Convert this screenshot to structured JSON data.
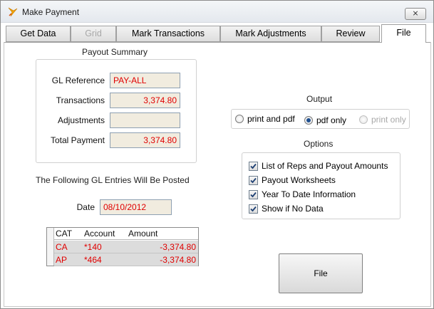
{
  "window": {
    "title": "Make Payment",
    "close_label": "⨯"
  },
  "tabs": [
    {
      "label": "Get Data",
      "state": "normal"
    },
    {
      "label": "Grid",
      "state": "disabled"
    },
    {
      "label": "Mark Transactions",
      "state": "normal"
    },
    {
      "label": "Mark Adjustments",
      "state": "normal"
    },
    {
      "label": "Review",
      "state": "normal"
    },
    {
      "label": "File",
      "state": "active"
    }
  ],
  "payout_summary": {
    "heading": "Payout Summary",
    "gl_reference_label": "GL Reference",
    "gl_reference_value": "PAY-ALL",
    "transactions_label": "Transactions",
    "transactions_value": "3,374.80",
    "adjustments_label": "Adjustments",
    "adjustments_value": "",
    "total_payment_label": "Total Payment",
    "total_payment_value": "3,374.80"
  },
  "gl_entries": {
    "heading": "The Following GL Entries Will Be Posted",
    "date_label": "Date",
    "date_value": "08/10/2012",
    "columns": [
      "CAT",
      "Account",
      "Amount"
    ],
    "rows": [
      {
        "cat": "CA",
        "account": "*140",
        "amount": "-3,374.80"
      },
      {
        "cat": "AP",
        "account": "*464",
        "amount": "-3,374.80"
      }
    ]
  },
  "output": {
    "heading": "Output",
    "options": [
      {
        "label": "print and pdf",
        "selected": false,
        "disabled": false
      },
      {
        "label": "pdf only",
        "selected": true,
        "disabled": false
      },
      {
        "label": "print only",
        "selected": false,
        "disabled": true
      }
    ]
  },
  "options": {
    "heading": "Options",
    "items": [
      {
        "label": "List of Reps and Payout Amounts",
        "checked": true
      },
      {
        "label": "Payout Worksheets",
        "checked": true
      },
      {
        "label": "Year To Date Information",
        "checked": true
      },
      {
        "label": "Show if No Data",
        "checked": true
      }
    ]
  },
  "file_button": {
    "label": "File"
  },
  "colors": {
    "accent_text": "#e00000",
    "field_bg": "#f1ecdf",
    "row_bg": "#dcdcdc"
  }
}
